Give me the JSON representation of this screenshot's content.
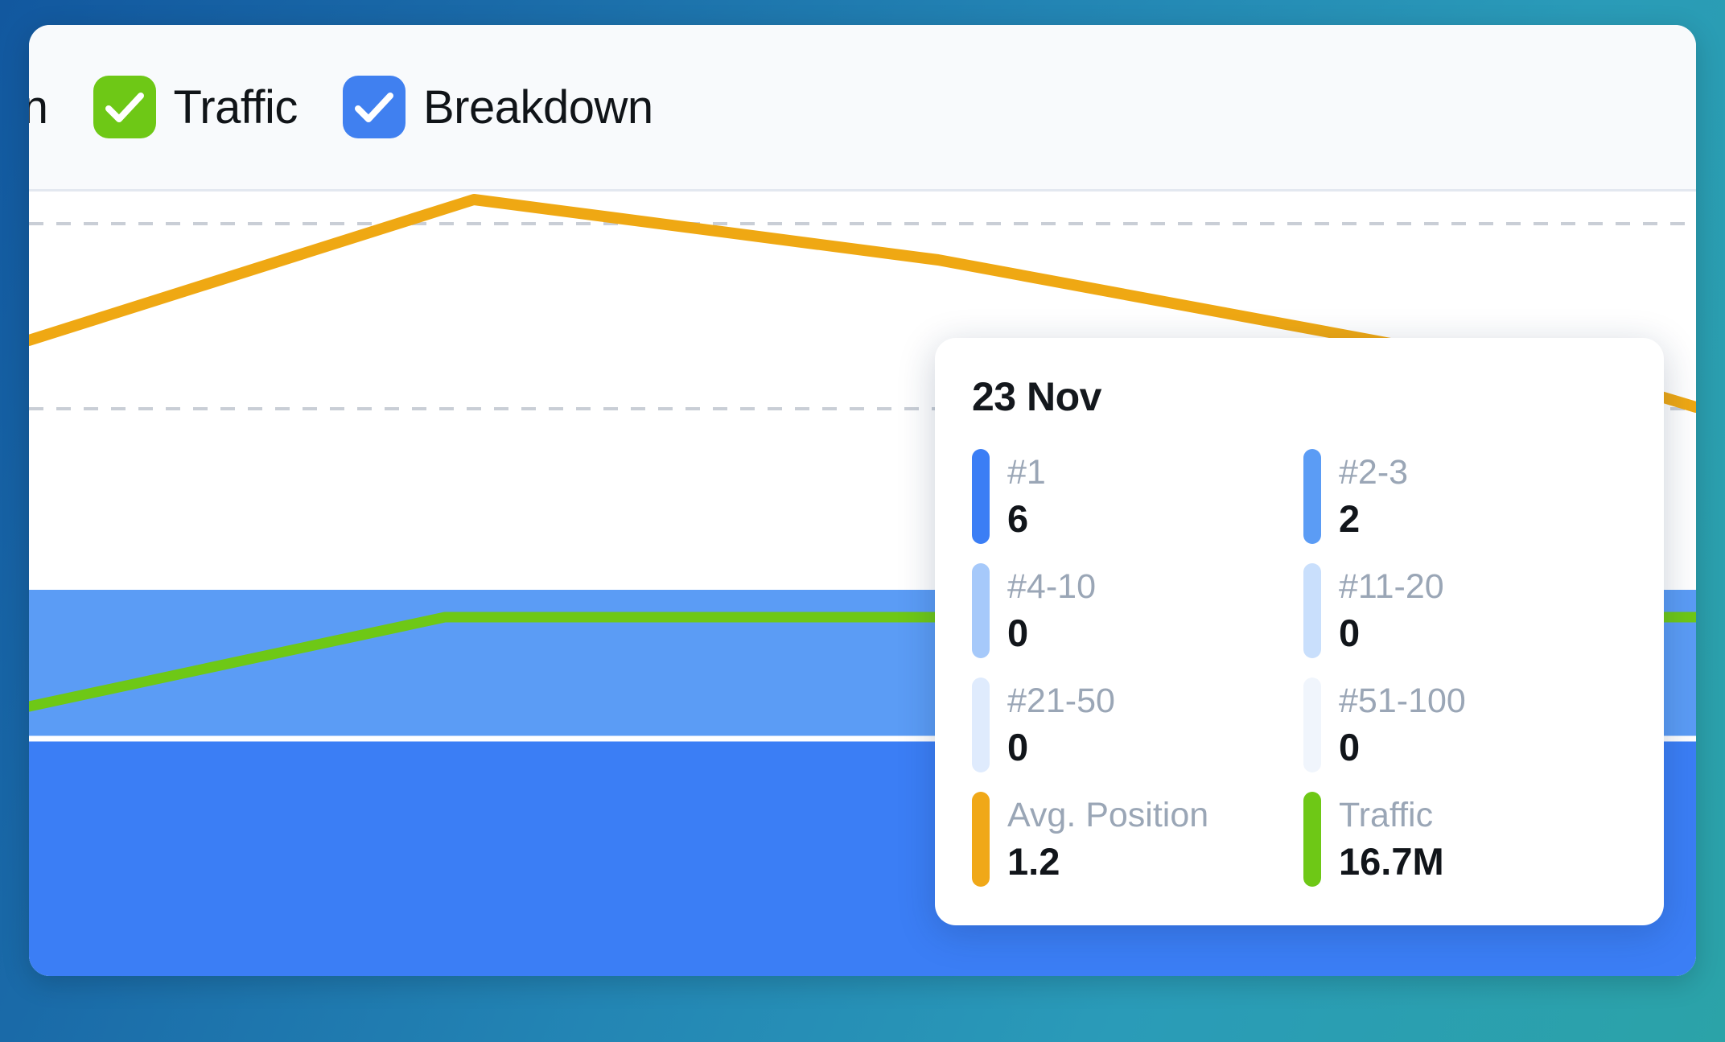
{
  "toolbar": {
    "items": [
      {
        "label": "on",
        "checkbox_color": "",
        "checked": false,
        "clipped": true,
        "icon": "none"
      },
      {
        "label": "Traffic",
        "checkbox_color": "#6ec816",
        "checked": true,
        "clipped": false,
        "icon": "check-icon"
      },
      {
        "label": "Breakdown",
        "checkbox_color": "#4080f0",
        "checked": true,
        "clipped": false,
        "icon": "check-icon"
      }
    ]
  },
  "tooltip": {
    "date": "23 Nov",
    "metrics": [
      {
        "name": "#1",
        "value": "6",
        "color": "#3b7ef5"
      },
      {
        "name": "#2-3",
        "value": "2",
        "color": "#5b9cf5"
      },
      {
        "name": "#4-10",
        "value": "0",
        "color": "#a6c9fa"
      },
      {
        "name": "#11-20",
        "value": "0",
        "color": "#c9dffc"
      },
      {
        "name": "#21-50",
        "value": "0",
        "color": "#dfebfd"
      },
      {
        "name": "#51-100",
        "value": "0",
        "color": "#f0f5fc"
      },
      {
        "name": "Avg. Position",
        "value": "1.2",
        "color": "#f0a818"
      },
      {
        "name": "Traffic",
        "value": "16.7M",
        "color": "#6ec816"
      }
    ]
  },
  "chart_data": {
    "type": "area",
    "title": "",
    "xlabel": "",
    "ylabel": "",
    "grid": true,
    "legend_position": "top",
    "highlighted_point": "23 Nov",
    "series": [
      {
        "name": "#1",
        "type": "area",
        "color": "#3b7ef5",
        "stack": "breakdown",
        "values": [
          6,
          6,
          6,
          6,
          6
        ]
      },
      {
        "name": "#2-3",
        "type": "area",
        "color": "#5b9cf5",
        "stack": "breakdown",
        "values": [
          2,
          2,
          2,
          2,
          2
        ]
      },
      {
        "name": "#4-10",
        "type": "area",
        "color": "#a6c9fa",
        "stack": "breakdown",
        "values": [
          0,
          0,
          0,
          0,
          0
        ]
      },
      {
        "name": "#11-20",
        "type": "area",
        "color": "#c9dffc",
        "stack": "breakdown",
        "values": [
          0,
          0,
          0,
          0,
          0
        ]
      },
      {
        "name": "#21-50",
        "type": "area",
        "color": "#dfebfd",
        "stack": "breakdown",
        "values": [
          0,
          0,
          0,
          0,
          0
        ]
      },
      {
        "name": "#51-100",
        "type": "area",
        "color": "#f0f5fc",
        "stack": "breakdown",
        "values": [
          0,
          0,
          0,
          0,
          0
        ]
      },
      {
        "name": "Avg. Position",
        "type": "line",
        "color": "#efa813",
        "values": [
          1.45,
          1.2,
          1.35,
          1.4,
          1.5
        ]
      },
      {
        "name": "Traffic",
        "type": "line",
        "color": "#6ec816",
        "values": [
          13.0,
          16.7,
          16.7,
          16.7,
          16.7
        ]
      }
    ]
  }
}
